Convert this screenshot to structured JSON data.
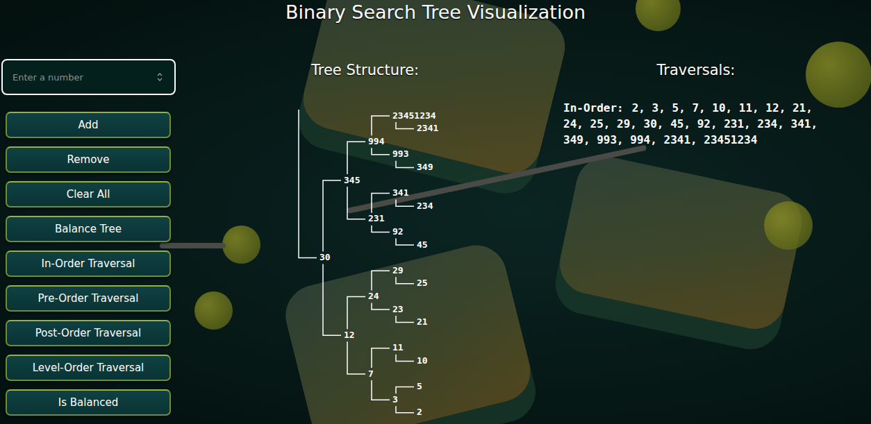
{
  "title": "Binary Search Tree Visualization",
  "input": {
    "placeholder": "Enter a number",
    "value": ""
  },
  "buttons": [
    "Add",
    "Remove",
    "Clear All",
    "Balance Tree",
    "In-Order Traversal",
    "Pre-Order Traversal",
    "Post-Order Traversal",
    "Level-Order Traversal",
    "Is Balanced"
  ],
  "tree_panel": {
    "heading": "Tree Structure:",
    "root": {
      "value": "30",
      "right": {
        "value": "345",
        "right": {
          "value": "994",
          "right": {
            "value": "23451234",
            "right": null,
            "left": {
              "value": "2341",
              "right": null,
              "left": null
            }
          },
          "left": {
            "value": "993",
            "right": null,
            "left": {
              "value": "349",
              "right": null,
              "left": null
            }
          }
        },
        "left": {
          "value": "231",
          "right": {
            "value": "341",
            "right": null,
            "left": {
              "value": "234",
              "right": null,
              "left": null
            }
          },
          "left": {
            "value": "92",
            "right": null,
            "left": {
              "value": "45",
              "right": null,
              "left": null
            }
          }
        }
      },
      "left": {
        "value": "12",
        "right": {
          "value": "24",
          "right": {
            "value": "29",
            "right": null,
            "left": {
              "value": "25",
              "right": null,
              "left": null
            }
          },
          "left": {
            "value": "23",
            "right": null,
            "left": {
              "value": "21",
              "right": null,
              "left": null
            }
          }
        },
        "left": {
          "value": "7",
          "right": {
            "value": "11",
            "right": null,
            "left": {
              "value": "10",
              "right": null,
              "left": null
            }
          },
          "left": {
            "value": "3",
            "right": {
              "value": "5",
              "right": null,
              "left": null
            },
            "left": {
              "value": "2",
              "right": null,
              "left": null
            }
          }
        }
      }
    }
  },
  "traversals": {
    "heading": "Traversals:",
    "label": "In-Order:",
    "lines": [
      "2, 3, 5, 7, 10, 11, 12, 21,",
      "24, 25, 29, 30, 45, 92, 231, 234, 341,",
      "349, 993, 994, 2341, 23451234"
    ]
  }
}
